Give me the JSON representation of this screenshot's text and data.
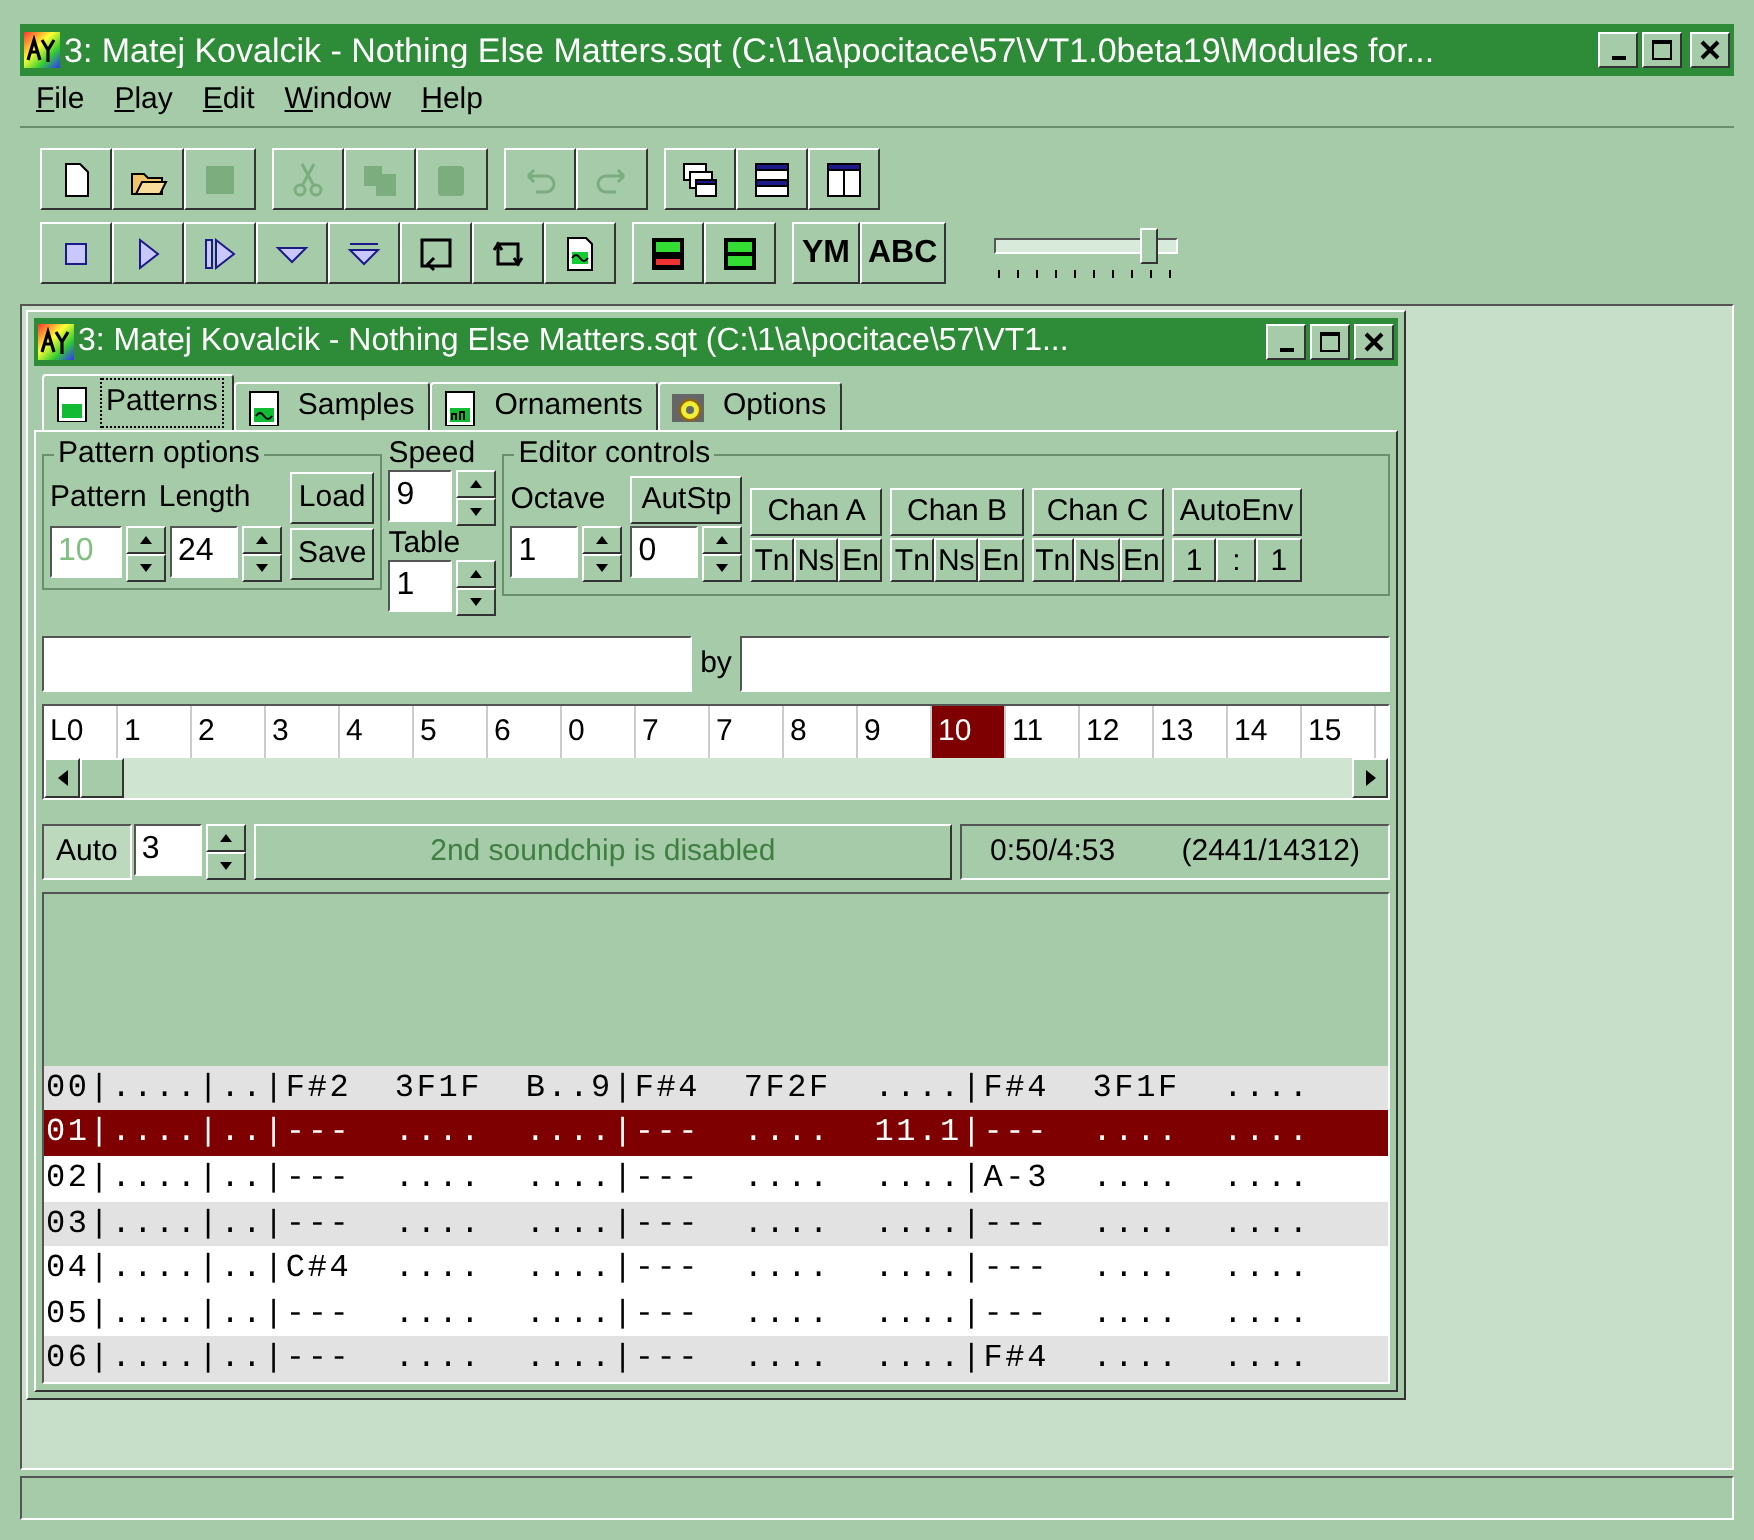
{
  "window": {
    "title": "3: Matej Kovalcik - Nothing Else Matters.sqt (C:\\1\\a\\pocitace\\57\\VT1.0beta19\\Modules for..."
  },
  "menu": [
    "File",
    "Play",
    "Edit",
    "Window",
    "Help"
  ],
  "toolbar_rows": [
    [
      [
        {
          "kind": "new",
          "disabled": false
        },
        {
          "kind": "open",
          "disabled": false
        },
        {
          "kind": "save",
          "disabled": true
        }
      ],
      [
        {
          "kind": "cut",
          "disabled": true
        },
        {
          "kind": "copy",
          "disabled": true
        },
        {
          "kind": "paste",
          "disabled": true
        }
      ],
      [
        {
          "kind": "undo",
          "disabled": true
        },
        {
          "kind": "redo",
          "disabled": true
        }
      ],
      [
        {
          "kind": "cascade",
          "disabled": false
        },
        {
          "kind": "tile_h",
          "disabled": false
        },
        {
          "kind": "tile_v",
          "disabled": false
        }
      ]
    ],
    [
      [
        {
          "kind": "stop",
          "disabled": false
        },
        {
          "kind": "play",
          "disabled": false
        },
        {
          "kind": "play_pattern",
          "disabled": false
        },
        {
          "kind": "down",
          "disabled": false
        },
        {
          "kind": "down_all",
          "disabled": false
        },
        {
          "kind": "loop",
          "disabled": false
        },
        {
          "kind": "loop_all",
          "disabled": false
        },
        {
          "kind": "wave",
          "disabled": false
        }
      ],
      [
        {
          "kind": "ab",
          "disabled": false
        },
        {
          "kind": "cn",
          "disabled": false
        }
      ],
      [
        {
          "kind": "text",
          "label": "YM",
          "disabled": false
        },
        {
          "kind": "text",
          "label": "ABC",
          "disabled": false
        }
      ]
    ]
  ],
  "volume_slider": {
    "level": 0.9
  },
  "child": {
    "title": "3: Matej Kovalcik - Nothing Else Matters.sqt (C:\\1\\a\\pocitace\\57\\VT1...",
    "tabs": [
      {
        "label": "Patterns",
        "selected": true,
        "kind": "patterns"
      },
      {
        "label": "Samples",
        "selected": false,
        "kind": "samples"
      },
      {
        "label": "Ornaments",
        "selected": false,
        "kind": "ornaments"
      },
      {
        "label": "Options",
        "selected": false,
        "kind": "options"
      }
    ],
    "pattern_options": {
      "title": "Pattern options",
      "pattern_label": "Pattern",
      "length_label": "Length",
      "pattern_value": "10",
      "pattern_disabled": true,
      "length_value": "24",
      "load": "Load",
      "save": "Save"
    },
    "speed": {
      "label": "Speed",
      "value": "9"
    },
    "table": {
      "label": "Table",
      "value": "1"
    },
    "editor_controls": {
      "title": "Editor controls",
      "octave_label": "Octave",
      "octave_value": "1",
      "autostep_label": "AutStp",
      "autostep_value": "0",
      "channels": [
        {
          "label": "Chan A",
          "toggles": [
            "Tn",
            "Ns",
            "En"
          ]
        },
        {
          "label": "Chan B",
          "toggles": [
            "Tn",
            "Ns",
            "En"
          ]
        },
        {
          "label": "Chan C",
          "toggles": [
            "Tn",
            "Ns",
            "En"
          ]
        }
      ],
      "autoenv": {
        "label": "AutoEnv",
        "values": [
          "1",
          ":",
          "1"
        ]
      }
    },
    "by_label": "by",
    "positions": [
      {
        "label": "L0",
        "selected": false
      },
      {
        "label": "1",
        "selected": false
      },
      {
        "label": "2",
        "selected": false
      },
      {
        "label": "3",
        "selected": false
      },
      {
        "label": "4",
        "selected": false
      },
      {
        "label": "5",
        "selected": false
      },
      {
        "label": "6",
        "selected": false
      },
      {
        "label": "0",
        "selected": false
      },
      {
        "label": "7",
        "selected": false
      },
      {
        "label": "7",
        "selected": false
      },
      {
        "label": "8",
        "selected": false
      },
      {
        "label": "9",
        "selected": false
      },
      {
        "label": "10",
        "selected": true
      },
      {
        "label": "11",
        "selected": false
      },
      {
        "label": "12",
        "selected": false
      },
      {
        "label": "13",
        "selected": false
      },
      {
        "label": "14",
        "selected": false
      },
      {
        "label": "15",
        "selected": false
      }
    ],
    "auto": {
      "label": "Auto",
      "on": true,
      "value": "3"
    },
    "chip_status": {
      "text": "2nd soundchip is disabled",
      "disabled": true
    },
    "time": "0:50/4:53",
    "ticks": "(2441/14312)",
    "pattern_rows": [
      {
        "text": "00|....|..|F#2  3F1F  B..9|F#4  7F2F  ....|F#4  3F1F  ....",
        "selected": false,
        "highlighted": true
      },
      {
        "text": "01|....|..|---  ....  ....|---  ....  11.1|---  ....  ....",
        "selected": true,
        "highlighted": false
      },
      {
        "text": "02|....|..|---  ....  ....|---  ....  ....|A-3  ....  ....",
        "selected": false,
        "highlighted": false
      },
      {
        "text": "03|....|..|---  ....  ....|---  ....  ....|---  ....  ....",
        "selected": false,
        "highlighted": true
      },
      {
        "text": "04|....|..|C#4  ....  ....|---  ....  ....|---  ....  ....",
        "selected": false,
        "highlighted": false
      },
      {
        "text": "05|....|..|---  ....  ....|---  ....  ....|---  ....  ....",
        "selected": false,
        "highlighted": false
      },
      {
        "text": "06|....|..|---  ....  ....|---  ....  ....|F#4  ....  ....",
        "selected": false,
        "highlighted": true
      }
    ]
  }
}
